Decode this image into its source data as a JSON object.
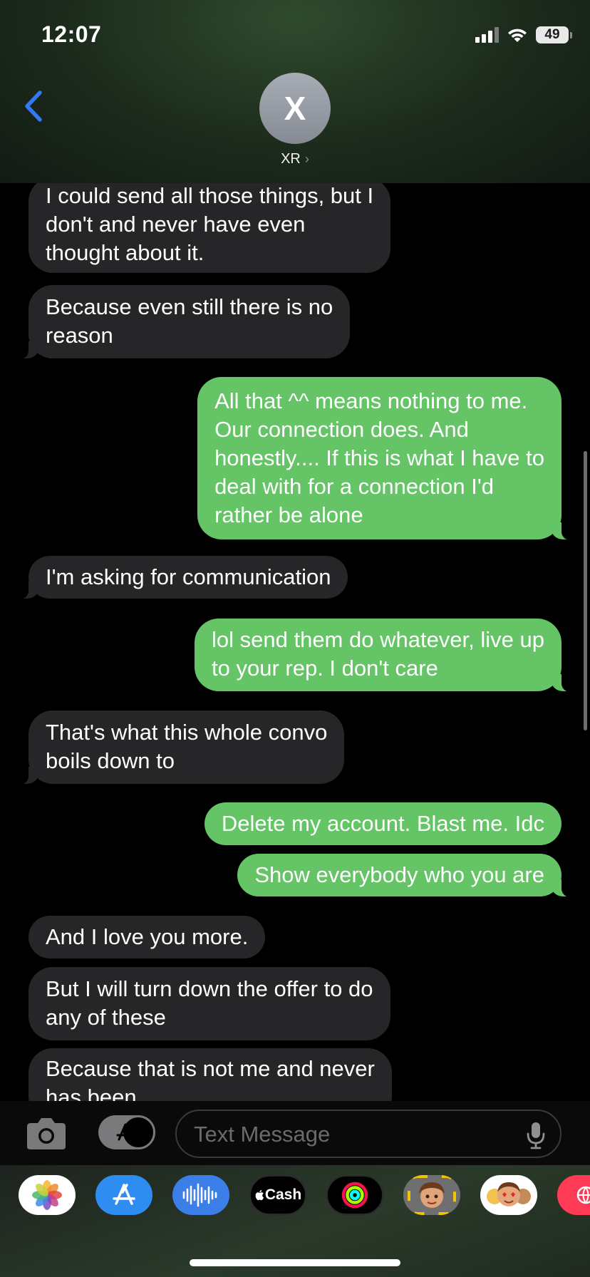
{
  "status_bar": {
    "time": "12:07",
    "battery": "49"
  },
  "header": {
    "avatar_initial": "X",
    "contact_name": "XR",
    "contact_chevron": "›"
  },
  "messages": [
    {
      "dir": "in",
      "lines": [
        "I could send all those things, but I",
        "don't and never have even",
        "thought about it."
      ]
    },
    {
      "dir": "in",
      "lines": [
        "Because even still there is no",
        "reason"
      ]
    },
    {
      "dir": "out",
      "lines": [
        "All that ^^ means nothing to me.",
        "Our connection does. And",
        "honestly.... If this is what I have to",
        "deal with for a connection I'd",
        "rather be alone"
      ]
    },
    {
      "dir": "in",
      "lines": [
        "I'm asking for communication"
      ]
    },
    {
      "dir": "out",
      "lines": [
        "lol send them do whatever, live up",
        "to your rep. I don't care"
      ]
    },
    {
      "dir": "in",
      "lines": [
        "That's what this whole convo",
        "boils down to"
      ]
    },
    {
      "dir": "out",
      "lines": [
        "Delete my account. Blast me. Idc"
      ]
    },
    {
      "dir": "out",
      "lines": [
        "Show everybody who you are"
      ]
    },
    {
      "dir": "in",
      "lines": [
        "And I love you more."
      ]
    },
    {
      "dir": "in",
      "lines": [
        "But I will turn down the offer to do",
        "any of these"
      ]
    },
    {
      "dir": "in",
      "lines": [
        "Because that is not me and never",
        "has been"
      ]
    }
  ],
  "input": {
    "placeholder": "Text Message"
  },
  "apps": {
    "photos": "photos-icon",
    "app_store": "app-store-icon",
    "audio": "audio-message-icon",
    "cash_label": "Cash",
    "fitness": "activity-rings-icon",
    "memoji": "memoji-icon",
    "stickers": "memoji-stickers-icon",
    "more": "more-apps-icon"
  },
  "colors": {
    "outgoing": "#65c466",
    "incoming": "#262628",
    "accent": "#3478f6"
  }
}
